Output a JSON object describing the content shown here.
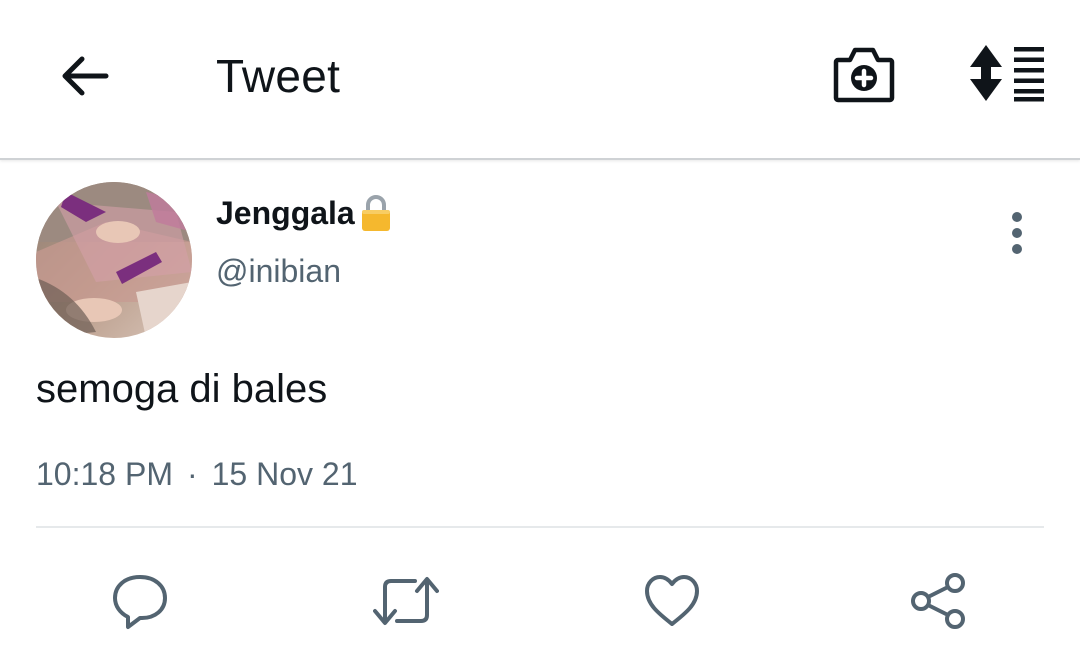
{
  "header": {
    "title": "Tweet",
    "back_icon": "arrow-left-icon",
    "camera_icon": "camera-plus-icon",
    "sort_icon": "sort-lines-icon"
  },
  "tweet": {
    "display_name": "Jenggala",
    "locked_icon": "lock-icon",
    "handle": "@inibian",
    "text": "semoga di bales",
    "time": "10:18 PM",
    "separator": "·",
    "date": "15 Nov 21"
  },
  "actions": {
    "reply_icon": "reply-icon",
    "retweet_icon": "retweet-icon",
    "like_icon": "heart-icon",
    "share_icon": "share-icon"
  },
  "colors": {
    "text_primary": "#0f1419",
    "text_secondary": "#536471",
    "icon_gray": "#536471",
    "lock_gold": "#f5b82e"
  }
}
